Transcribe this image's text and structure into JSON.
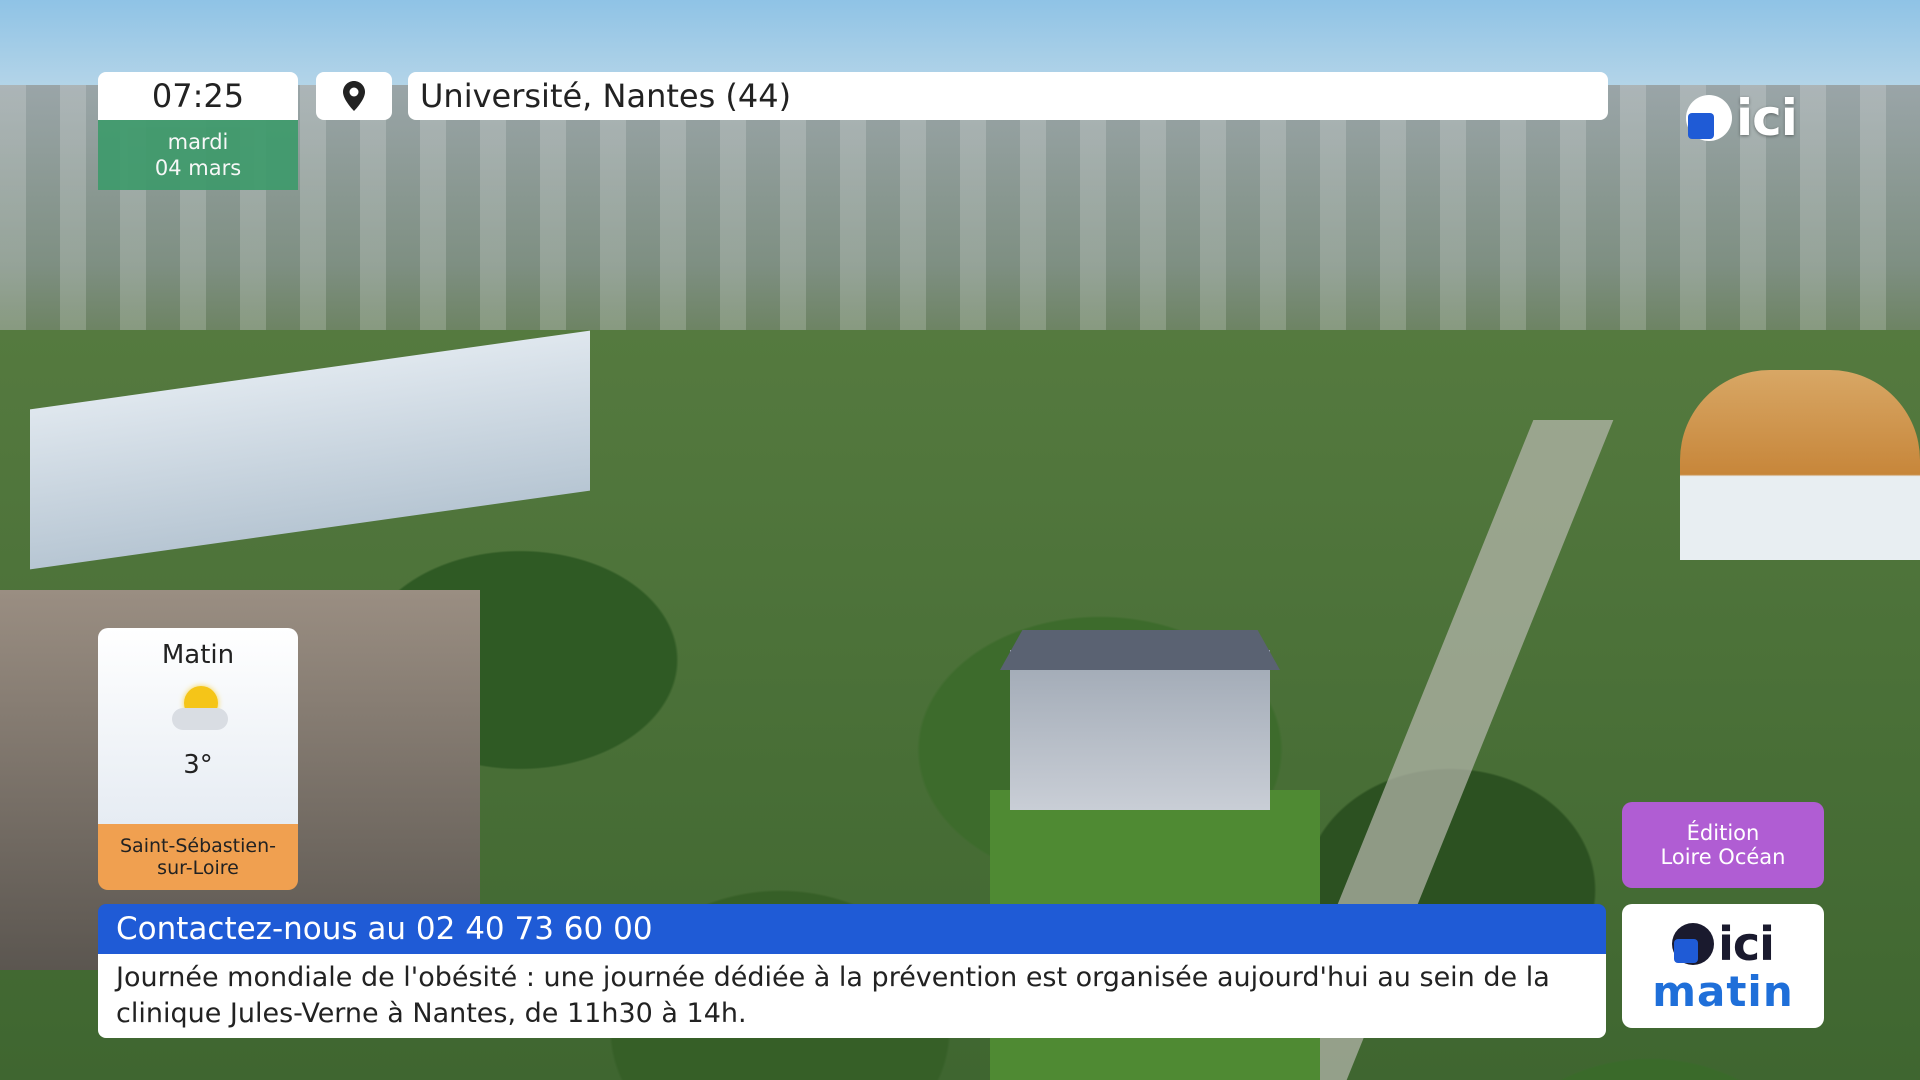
{
  "header": {
    "time": "07:25",
    "day": "mardi",
    "date": "04 mars",
    "location": "Université, Nantes (44)"
  },
  "logo_top": {
    "text": "ici"
  },
  "weather": {
    "period": "Matin",
    "icon": "sun-cloud-icon",
    "temperature": "3°",
    "city": "Saint-Sébastien-sur-Loire"
  },
  "edition": {
    "line1": "Édition",
    "line2": "Loire Océan"
  },
  "ticker": {
    "headline": "Contactez-nous au 02 40 73 60 00",
    "text": "Journée mondiale de l'obésité : une journée dédiée à la prévention est organisée aujourd'hui au sein de la clinique Jules-Verne à Nantes, de 11h30 à 14h."
  },
  "logo_bottom": {
    "brand": "ici",
    "program": "matin"
  },
  "colors": {
    "accent_blue": "#1f5bd6",
    "date_green": "#3e9a6b",
    "weather_orange": "#f0a050",
    "edition_purple": "#b05dd3"
  }
}
